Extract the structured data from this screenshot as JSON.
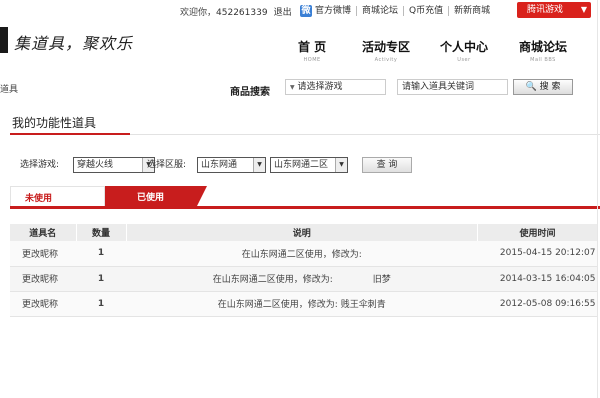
{
  "topbar": {
    "welcome": "欢迎你，",
    "uid": "452261339",
    "logout": "退出",
    "weibo": "官方微博",
    "links": [
      "商城论坛",
      "Q币充值",
      "新新商城"
    ],
    "tencent_games": "腾讯游戏",
    "weibo_icon": "weibo-icon"
  },
  "logo": {
    "slogan": "集道具，聚欢乐"
  },
  "nav": [
    {
      "cn": "首 页",
      "en": "HOME"
    },
    {
      "cn": "活动专区",
      "en": "Activity"
    },
    {
      "cn": "个人中心",
      "en": "User"
    },
    {
      "cn": "商城论坛",
      "en": "Mall BBS"
    }
  ],
  "search": {
    "crumb": "道具",
    "label": "商品搜索",
    "game_select": "请选择游戏",
    "keyword_value": "请输入道具关键词",
    "button": "搜  索"
  },
  "page": {
    "title": "我的功能性道具"
  },
  "filter": {
    "game_label": "选择游戏:",
    "game_value": "穿越火线",
    "server_label": "选择区服:",
    "region_value": "山东网通",
    "server_value": "山东网通二区",
    "query": "查 询"
  },
  "tabs": {
    "unused": "未使用",
    "used": "已使用"
  },
  "table": {
    "headers": [
      "道具名",
      "数量",
      "说明",
      "使用时间"
    ],
    "rows": [
      {
        "name": "更改昵称",
        "qty": "1",
        "desc": "在山东网通二区使用，修改为:",
        "time": "2015-04-15 20:12:07"
      },
      {
        "name": "更改昵称",
        "qty": "1",
        "desc": "在山东网通二区使用，修改为:              旧梦",
        "time": "2014-03-15 16:04:05"
      },
      {
        "name": "更改昵称",
        "qty": "1",
        "desc": "在山东网通二区使用，修改为: 贱王伞刺青",
        "time": "2012-05-08 09:16:55"
      }
    ]
  },
  "colors": {
    "accent": "#c81d1d",
    "header_bg": "#ececec"
  }
}
